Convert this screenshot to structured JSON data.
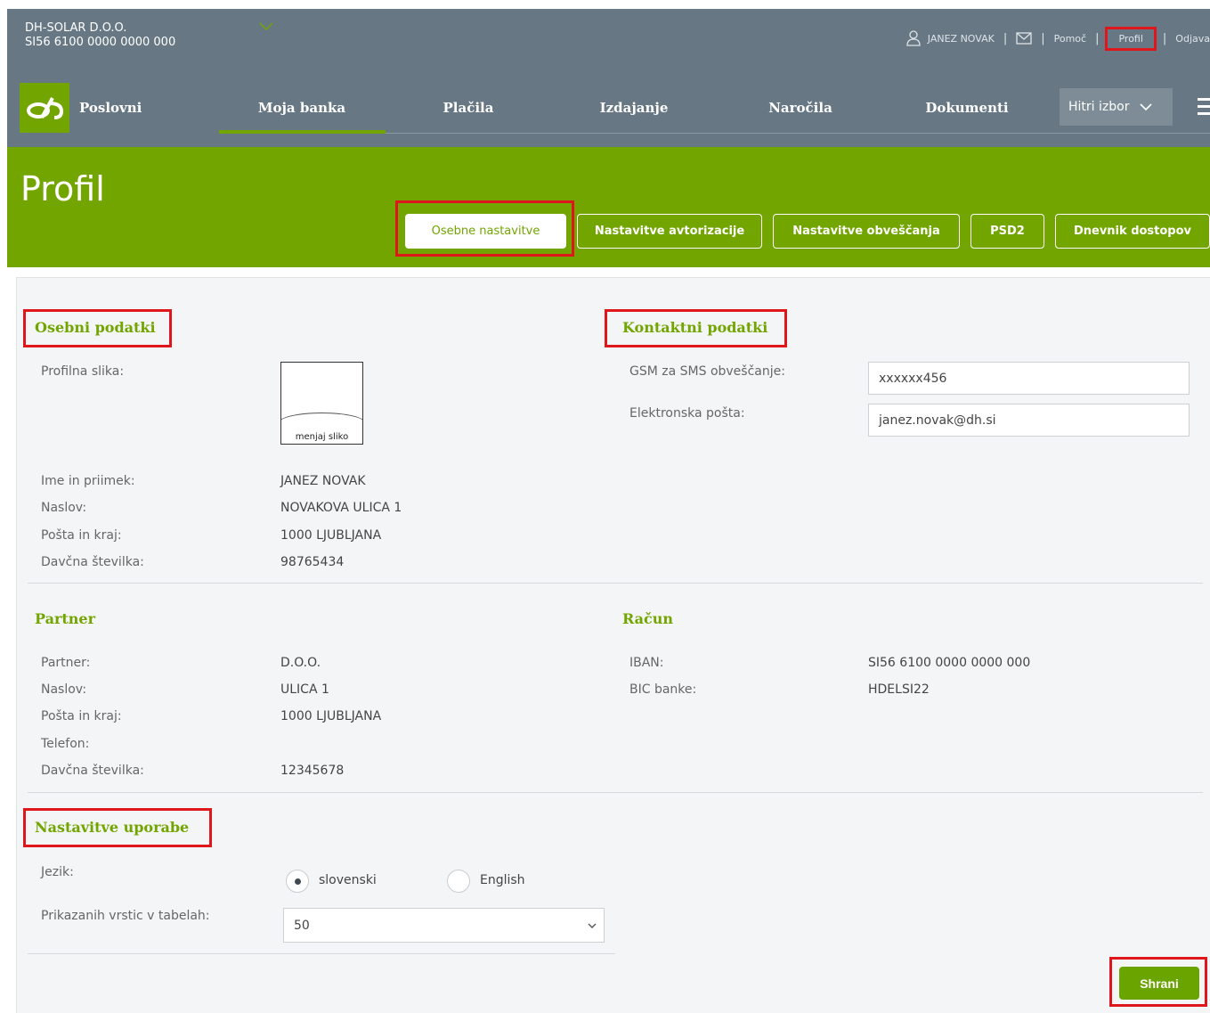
{
  "header": {
    "company_name": "DH-SOLAR D.O.O.",
    "company_iban": "SI56 6100 0000 0000 000",
    "user_name": "JANEZ NOVAK",
    "links": {
      "pomoc": "Pomoč",
      "profil": "Profil",
      "odjava": "Odjava"
    },
    "icons": [
      "user-icon",
      "mail-icon",
      "chevron-down-icon",
      "menu-icon"
    ]
  },
  "nav": {
    "brand": "Poslovni",
    "items": [
      "Moja banka",
      "Plačila",
      "Izdajanje",
      "Naročila",
      "Dokumenti"
    ],
    "active": "Moja banka",
    "hitri_izbor": "Hitri izbor"
  },
  "page": {
    "title": "Profil",
    "tabs": [
      "Osebne nastavitve",
      "Nastavitve avtorizacije",
      "Nastavitve obveščanja",
      "PSD2",
      "Dnevnik dostopov"
    ],
    "active_tab": "Osebne nastavitve"
  },
  "osebni": {
    "title": "Osebni podatki",
    "photo_label": "Profilna slika:",
    "photo_button": "menjaj sliko",
    "rows": [
      {
        "label": "Ime in priimek:",
        "value": "JANEZ NOVAK"
      },
      {
        "label": "Naslov:",
        "value": "NOVAKOVA ULICA 1"
      },
      {
        "label": "Pošta in kraj:",
        "value": "1000 LJUBLJANA"
      },
      {
        "label": "Davčna številka:",
        "value": "98765434"
      }
    ]
  },
  "kontakt": {
    "title": "Kontaktni podatki",
    "gsm_label": "GSM za SMS obveščanje:",
    "gsm_value": "xxxxxx456",
    "email_label": "Elektronska pošta:",
    "email_value": "janez.novak@dh.si"
  },
  "partner": {
    "title": "Partner",
    "rows": [
      {
        "label": "Partner:",
        "value": "D.O.O."
      },
      {
        "label": "Naslov:",
        "value": "ULICA 1"
      },
      {
        "label": "Pošta in kraj:",
        "value": "1000 LJUBLJANA"
      },
      {
        "label": "Telefon:",
        "value": ""
      },
      {
        "label": "Davčna številka:",
        "value": "12345678"
      }
    ]
  },
  "racun": {
    "title": "Račun",
    "rows": [
      {
        "label": "IBAN:",
        "value": "SI56 6100 0000 0000 000"
      },
      {
        "label": "BIC banke:",
        "value": "HDELSI22"
      }
    ]
  },
  "uporaba": {
    "title": "Nastavitve uporabe",
    "lang_label": "Jezik:",
    "lang_options": [
      "slovenski",
      "English"
    ],
    "lang_selected": "slovenski",
    "rows_label": "Prikazanih vrstic v tabelah:",
    "rows_value": "50"
  },
  "actions": {
    "save": "Shrani"
  },
  "colors": {
    "header": "#677884",
    "accent": "#72a500",
    "highlight": "#e0161d"
  }
}
